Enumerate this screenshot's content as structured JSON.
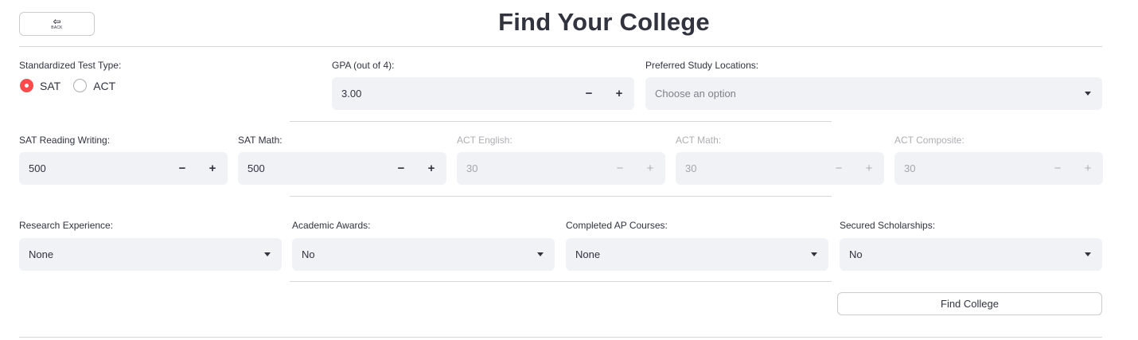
{
  "back_button": {
    "label": "BACK",
    "icon": "left-arrow-icon"
  },
  "title": "Find Your College",
  "test_type": {
    "label": "Standardized Test Type:",
    "options": [
      {
        "label": "SAT",
        "selected": true
      },
      {
        "label": "ACT",
        "selected": false
      }
    ],
    "accent_color": "#ff4b4b"
  },
  "gpa": {
    "label": "GPA (out of 4):",
    "value": "3.00"
  },
  "locations": {
    "label": "Preferred Study Locations:",
    "placeholder": "Choose an option"
  },
  "scores": {
    "sat_rw": {
      "label": "SAT Reading Writing:",
      "value": "500"
    },
    "sat_math": {
      "label": "SAT Math:",
      "value": "500"
    },
    "act_english": {
      "label": "ACT English:",
      "value": "30"
    },
    "act_math": {
      "label": "ACT Math:",
      "value": "30"
    },
    "act_composite": {
      "label": "ACT Composite:",
      "value": "30"
    }
  },
  "selects": {
    "research": {
      "label": "Research Experience:",
      "value": "None"
    },
    "awards": {
      "label": "Academic Awards:",
      "value": "No"
    },
    "ap": {
      "label": "Completed AP Courses:",
      "value": "None"
    },
    "scholarships": {
      "label": "Secured Scholarships:",
      "value": "No"
    }
  },
  "stepper": {
    "minus": "−",
    "plus": "+"
  },
  "find_button": {
    "label": "Find College"
  }
}
